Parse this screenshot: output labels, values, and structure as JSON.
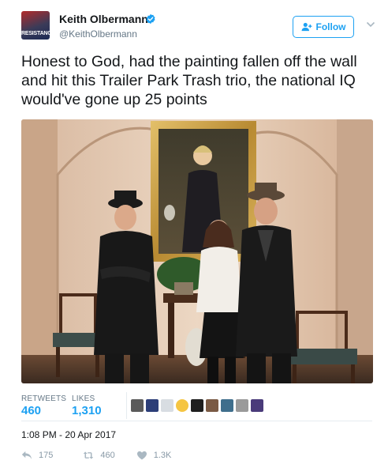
{
  "author": {
    "name": "Keith Olbermann",
    "handle": "@KeithOlbermann",
    "avatar_text": "RESISTANCE"
  },
  "follow_label": "Follow",
  "tweet": {
    "text": "Honest to God, had the painting fallen off the wall and hit this Trailer Park Trash trio, the national IQ would've gone up 25 points"
  },
  "stats": {
    "retweets_label": "RETWEETS",
    "retweets": "460",
    "likes_label": "LIKES",
    "likes": "1,310"
  },
  "timestamp": "1:08 PM - 20 Apr 2017",
  "actions": {
    "reply_count": "175",
    "retweet_count": "460",
    "like_count": "1.3K"
  },
  "colors": {
    "accent": "#1da1f2",
    "muted": "#657786",
    "action_gray": "#8899a6",
    "divider": "#e6ecf0"
  },
  "icons": [
    "verified-badge-icon",
    "follow-person-icon",
    "caret-down-icon",
    "reply-icon",
    "retweet-icon",
    "heart-icon"
  ]
}
